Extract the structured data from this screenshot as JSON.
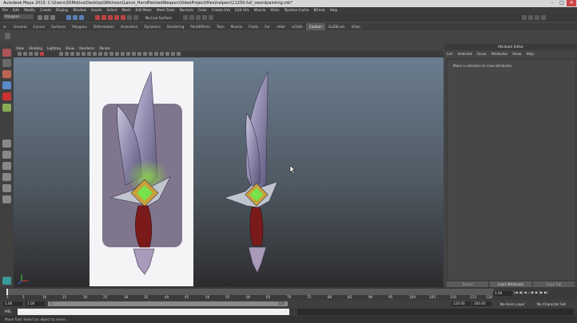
{
  "window": {
    "title": "Autodesk Maya 2015: C:\\Users\\3DMotive\\Desktop\\Wikinson\\Lance_HandPaintedWeapon\\VideoProject\\files\\helpers\\11250-full_swordpainting.mb*",
    "minimize": "–",
    "maximize": "□",
    "close": "✕"
  },
  "menubar": [
    "File",
    "Edit",
    "Modify",
    "Create",
    "Display",
    "Window",
    "Assets",
    "Select",
    "Mesh",
    "Edit Mesh",
    "Mesh Tools",
    "Normals",
    "Color",
    "Create UVs",
    "Edit UVs",
    "Muscle",
    "XGen",
    "Pipeline Cache",
    "BiFrost",
    "Help"
  ],
  "statusline": {
    "mode": "Polygons",
    "live_surface": "No Live Surface"
  },
  "shelf_tabs": [
    "General",
    "Curves",
    "Surfaces",
    "Polygons",
    "Deformation",
    "Animation",
    "Dynamics",
    "Rendering",
    "PaintEffects",
    "Toon",
    "Muscle",
    "Fluids",
    "Fur",
    "nHair",
    "nCloth",
    "Custom",
    "GoZBrush",
    "XGen"
  ],
  "shelf_active": "Custom",
  "panel_menu": [
    "View",
    "Shading",
    "Lighting",
    "Show",
    "Renderer",
    "Panels"
  ],
  "attribute_editor": {
    "title": "Attribute Editor",
    "menu": [
      "List",
      "Selected",
      "Focus",
      "Attributes",
      "Show",
      "Help"
    ],
    "message": "Make a selection to view attributes",
    "select_button": "Select",
    "load_button": "Load Attributes",
    "copy_button": "Copy Tab"
  },
  "timeline": {
    "ticks": [
      "1",
      "5",
      "10",
      "15",
      "20",
      "25",
      "30",
      "35",
      "40",
      "45",
      "50",
      "55",
      "60",
      "65",
      "70",
      "75",
      "80",
      "85",
      "90",
      "95",
      "100",
      "105",
      "110",
      "115",
      "120"
    ],
    "current_frame": "1.00"
  },
  "range": {
    "start": "1.00",
    "range_start": "1.00",
    "range_box_start": "1",
    "range_box_end": "120",
    "range_end": "120.00",
    "end": "200.00",
    "anim_layer": "No Anim Layer",
    "character_set": "No Character Set"
  },
  "command_line": {
    "label": "MEL"
  },
  "help_line": {
    "text": "Move Tool: Select an object to move."
  },
  "viewport": {
    "axis_label": "persp"
  }
}
